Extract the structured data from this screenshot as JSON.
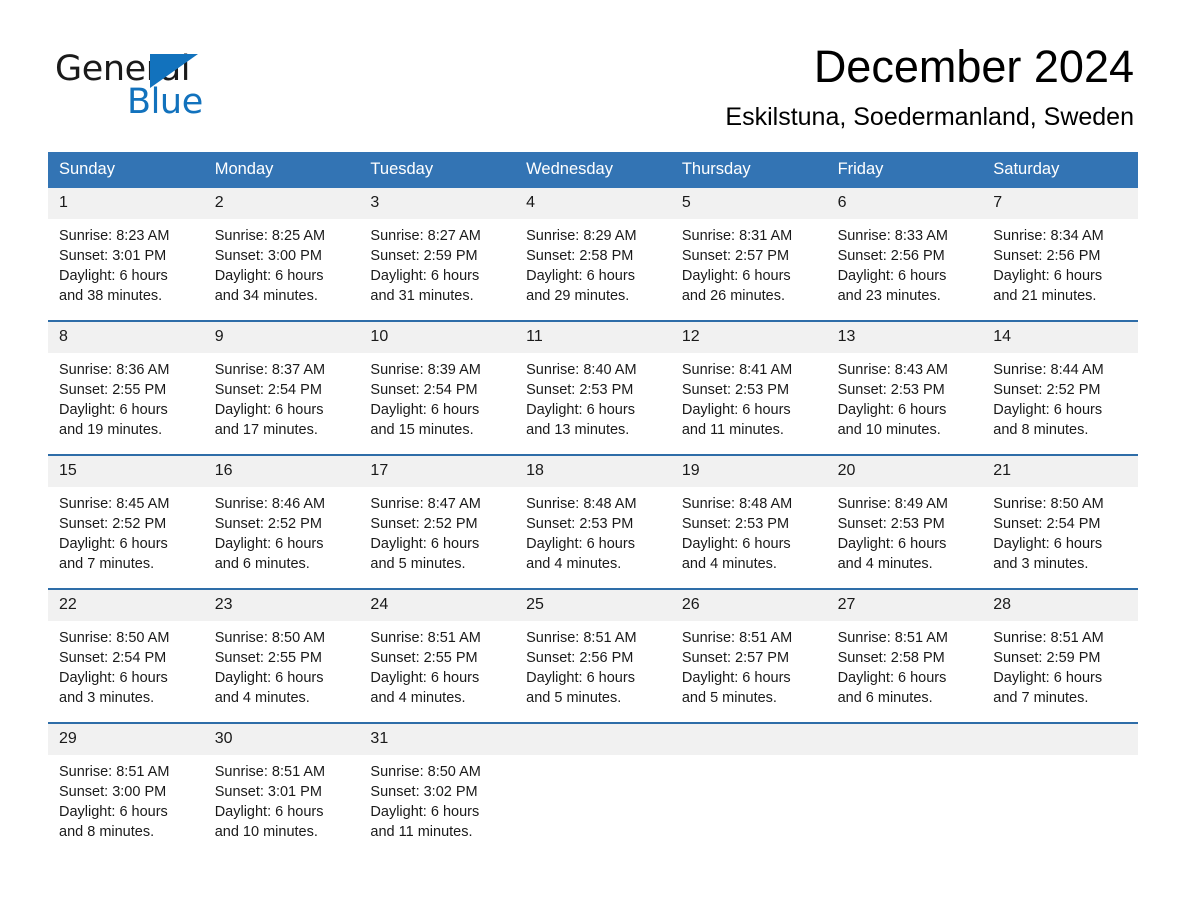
{
  "brand": {
    "name_part1": "General",
    "name_part2": "Blue",
    "logo_icon": "triangle-mark",
    "accent_color": "#1272bd"
  },
  "header": {
    "month_title": "December 2024",
    "location": "Eskilstuna, Soedermanland, Sweden"
  },
  "calendar": {
    "header_bg_color": "#3374b4",
    "row_divider_color": "#2e6da8",
    "daynum_bg_color": "#f1f1f1",
    "weekdays": [
      "Sunday",
      "Monday",
      "Tuesday",
      "Wednesday",
      "Thursday",
      "Friday",
      "Saturday"
    ],
    "weeks": [
      [
        {
          "day": "1",
          "lines": [
            "Sunrise: 8:23 AM",
            "Sunset: 3:01 PM",
            "Daylight: 6 hours",
            "and 38 minutes."
          ]
        },
        {
          "day": "2",
          "lines": [
            "Sunrise: 8:25 AM",
            "Sunset: 3:00 PM",
            "Daylight: 6 hours",
            "and 34 minutes."
          ]
        },
        {
          "day": "3",
          "lines": [
            "Sunrise: 8:27 AM",
            "Sunset: 2:59 PM",
            "Daylight: 6 hours",
            "and 31 minutes."
          ]
        },
        {
          "day": "4",
          "lines": [
            "Sunrise: 8:29 AM",
            "Sunset: 2:58 PM",
            "Daylight: 6 hours",
            "and 29 minutes."
          ]
        },
        {
          "day": "5",
          "lines": [
            "Sunrise: 8:31 AM",
            "Sunset: 2:57 PM",
            "Daylight: 6 hours",
            "and 26 minutes."
          ]
        },
        {
          "day": "6",
          "lines": [
            "Sunrise: 8:33 AM",
            "Sunset: 2:56 PM",
            "Daylight: 6 hours",
            "and 23 minutes."
          ]
        },
        {
          "day": "7",
          "lines": [
            "Sunrise: 8:34 AM",
            "Sunset: 2:56 PM",
            "Daylight: 6 hours",
            "and 21 minutes."
          ]
        }
      ],
      [
        {
          "day": "8",
          "lines": [
            "Sunrise: 8:36 AM",
            "Sunset: 2:55 PM",
            "Daylight: 6 hours",
            "and 19 minutes."
          ]
        },
        {
          "day": "9",
          "lines": [
            "Sunrise: 8:37 AM",
            "Sunset: 2:54 PM",
            "Daylight: 6 hours",
            "and 17 minutes."
          ]
        },
        {
          "day": "10",
          "lines": [
            "Sunrise: 8:39 AM",
            "Sunset: 2:54 PM",
            "Daylight: 6 hours",
            "and 15 minutes."
          ]
        },
        {
          "day": "11",
          "lines": [
            "Sunrise: 8:40 AM",
            "Sunset: 2:53 PM",
            "Daylight: 6 hours",
            "and 13 minutes."
          ]
        },
        {
          "day": "12",
          "lines": [
            "Sunrise: 8:41 AM",
            "Sunset: 2:53 PM",
            "Daylight: 6 hours",
            "and 11 minutes."
          ]
        },
        {
          "day": "13",
          "lines": [
            "Sunrise: 8:43 AM",
            "Sunset: 2:53 PM",
            "Daylight: 6 hours",
            "and 10 minutes."
          ]
        },
        {
          "day": "14",
          "lines": [
            "Sunrise: 8:44 AM",
            "Sunset: 2:52 PM",
            "Daylight: 6 hours",
            "and 8 minutes."
          ]
        }
      ],
      [
        {
          "day": "15",
          "lines": [
            "Sunrise: 8:45 AM",
            "Sunset: 2:52 PM",
            "Daylight: 6 hours",
            "and 7 minutes."
          ]
        },
        {
          "day": "16",
          "lines": [
            "Sunrise: 8:46 AM",
            "Sunset: 2:52 PM",
            "Daylight: 6 hours",
            "and 6 minutes."
          ]
        },
        {
          "day": "17",
          "lines": [
            "Sunrise: 8:47 AM",
            "Sunset: 2:52 PM",
            "Daylight: 6 hours",
            "and 5 minutes."
          ]
        },
        {
          "day": "18",
          "lines": [
            "Sunrise: 8:48 AM",
            "Sunset: 2:53 PM",
            "Daylight: 6 hours",
            "and 4 minutes."
          ]
        },
        {
          "day": "19",
          "lines": [
            "Sunrise: 8:48 AM",
            "Sunset: 2:53 PM",
            "Daylight: 6 hours",
            "and 4 minutes."
          ]
        },
        {
          "day": "20",
          "lines": [
            "Sunrise: 8:49 AM",
            "Sunset: 2:53 PM",
            "Daylight: 6 hours",
            "and 4 minutes."
          ]
        },
        {
          "day": "21",
          "lines": [
            "Sunrise: 8:50 AM",
            "Sunset: 2:54 PM",
            "Daylight: 6 hours",
            "and 3 minutes."
          ]
        }
      ],
      [
        {
          "day": "22",
          "lines": [
            "Sunrise: 8:50 AM",
            "Sunset: 2:54 PM",
            "Daylight: 6 hours",
            "and 3 minutes."
          ]
        },
        {
          "day": "23",
          "lines": [
            "Sunrise: 8:50 AM",
            "Sunset: 2:55 PM",
            "Daylight: 6 hours",
            "and 4 minutes."
          ]
        },
        {
          "day": "24",
          "lines": [
            "Sunrise: 8:51 AM",
            "Sunset: 2:55 PM",
            "Daylight: 6 hours",
            "and 4 minutes."
          ]
        },
        {
          "day": "25",
          "lines": [
            "Sunrise: 8:51 AM",
            "Sunset: 2:56 PM",
            "Daylight: 6 hours",
            "and 5 minutes."
          ]
        },
        {
          "day": "26",
          "lines": [
            "Sunrise: 8:51 AM",
            "Sunset: 2:57 PM",
            "Daylight: 6 hours",
            "and 5 minutes."
          ]
        },
        {
          "day": "27",
          "lines": [
            "Sunrise: 8:51 AM",
            "Sunset: 2:58 PM",
            "Daylight: 6 hours",
            "and 6 minutes."
          ]
        },
        {
          "day": "28",
          "lines": [
            "Sunrise: 8:51 AM",
            "Sunset: 2:59 PM",
            "Daylight: 6 hours",
            "and 7 minutes."
          ]
        }
      ],
      [
        {
          "day": "29",
          "lines": [
            "Sunrise: 8:51 AM",
            "Sunset: 3:00 PM",
            "Daylight: 6 hours",
            "and 8 minutes."
          ]
        },
        {
          "day": "30",
          "lines": [
            "Sunrise: 8:51 AM",
            "Sunset: 3:01 PM",
            "Daylight: 6 hours",
            "and 10 minutes."
          ]
        },
        {
          "day": "31",
          "lines": [
            "Sunrise: 8:50 AM",
            "Sunset: 3:02 PM",
            "Daylight: 6 hours",
            "and 11 minutes."
          ]
        },
        {
          "day": "",
          "lines": []
        },
        {
          "day": "",
          "lines": []
        },
        {
          "day": "",
          "lines": []
        },
        {
          "day": "",
          "lines": []
        }
      ]
    ]
  }
}
